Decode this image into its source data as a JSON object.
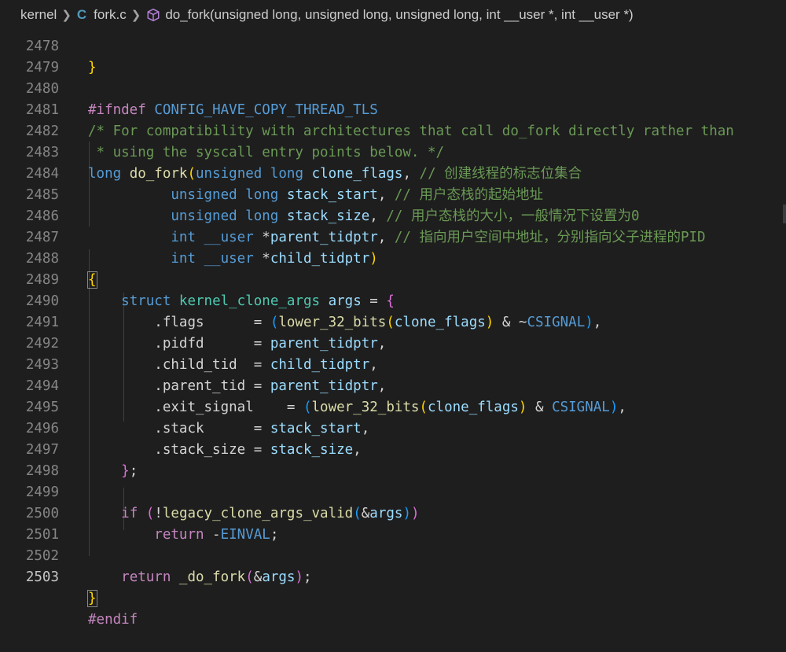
{
  "breadcrumb": {
    "folder": "kernel",
    "file_icon": "C",
    "file": "fork.c",
    "symbol": "do_fork(unsigned long, unsigned long, unsigned long, int __user *, int __user *)"
  },
  "lines": [
    {
      "n": "2478"
    },
    {
      "n": "2479"
    },
    {
      "n": "2480"
    },
    {
      "n": "2481"
    },
    {
      "n": "2482"
    },
    {
      "n": "2483"
    },
    {
      "n": "2484"
    },
    {
      "n": "2485"
    },
    {
      "n": "2486"
    },
    {
      "n": "2487"
    },
    {
      "n": "2488"
    },
    {
      "n": "2489"
    },
    {
      "n": "2490"
    },
    {
      "n": "2491"
    },
    {
      "n": "2492"
    },
    {
      "n": "2493"
    },
    {
      "n": "2494"
    },
    {
      "n": "2495"
    },
    {
      "n": "2496"
    },
    {
      "n": "2497"
    },
    {
      "n": "2498"
    },
    {
      "n": "2499"
    },
    {
      "n": "2500"
    },
    {
      "n": "2501"
    },
    {
      "n": "2502"
    },
    {
      "n": "2503"
    }
  ],
  "code": {
    "l2479": {
      "pp": "#ifndef",
      "mac": "CONFIG_HAVE_COPY_THREAD_TLS"
    },
    "l2480": "/* For compatibility with architectures that call do_fork directly rather than",
    "l2481": " * using the syscall entry points below. */",
    "l2482": {
      "c1": "long",
      "fn": "do_fork",
      "c2": "unsigned",
      "c3": "long",
      "v": "clone_flags",
      "cm": "// 创建线程的标志位集合"
    },
    "l2483": {
      "c1": "unsigned",
      "c2": "long",
      "v": "stack_start",
      "cm": "// 用户态栈的起始地址"
    },
    "l2484": {
      "c1": "unsigned",
      "c2": "long",
      "v": "stack_size",
      "cm": "// 用户态栈的大小，一般情况下设置为0"
    },
    "l2485": {
      "c1": "int",
      "c2": "__user",
      "v": "parent_tidptr",
      "cm": "// 指向用户空间中地址，分别指向父子进程的PID"
    },
    "l2486": {
      "c1": "int",
      "c2": "__user",
      "v": "child_tidptr"
    },
    "l2488": {
      "kw": "struct",
      "ty": "kernel_clone_args",
      "v": "args"
    },
    "l2489": {
      "f": ".flags",
      "fn": "lower_32_bits",
      "v": "clone_flags",
      "mac": "CSIGNAL"
    },
    "l2490": {
      "f": ".pidfd",
      "v": "parent_tidptr"
    },
    "l2491": {
      "f": ".child_tid",
      "v": "child_tidptr"
    },
    "l2492": {
      "f": ".parent_tid",
      "v": "parent_tidptr"
    },
    "l2493": {
      "f": ".exit_signal",
      "fn": "lower_32_bits",
      "v": "clone_flags",
      "mac": "CSIGNAL"
    },
    "l2494": {
      "f": ".stack",
      "v": "stack_start"
    },
    "l2495": {
      "f": ".stack_size",
      "v": "stack_size"
    },
    "l2498": {
      "ctl": "if",
      "fn": "legacy_clone_args_valid",
      "v": "args"
    },
    "l2499": {
      "ctl": "return",
      "mac": "EINVAL"
    },
    "l2501": {
      "ctl": "return",
      "fn": "_do_fork",
      "v": "args"
    },
    "l2503": {
      "pp": "#endif"
    }
  }
}
